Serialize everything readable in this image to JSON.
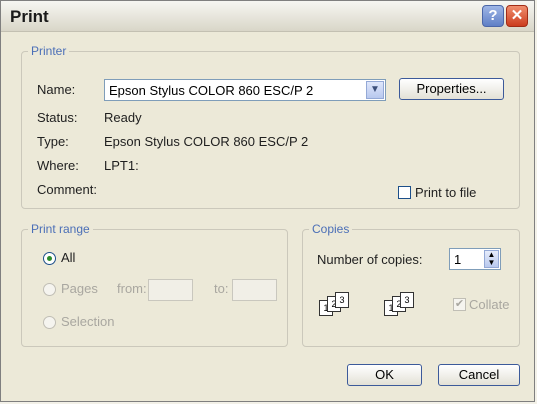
{
  "window": {
    "title": "Print",
    "help_glyph": "?",
    "close_glyph": "✕"
  },
  "printer": {
    "group_label": "Printer",
    "name_label": "Name:",
    "name_value": "Epson Stylus COLOR 860 ESC/P 2",
    "properties_label": "Properties...",
    "status_label": "Status:",
    "status_value": "Ready",
    "type_label": "Type:",
    "type_value": "Epson Stylus COLOR 860 ESC/P 2",
    "where_label": "Where:",
    "where_value": "LPT1:",
    "comment_label": "Comment:",
    "comment_value": "",
    "print_to_file_label": "Print to file"
  },
  "print_range": {
    "group_label": "Print range",
    "all_label": "All",
    "pages_label": "Pages",
    "from_label": "from:",
    "to_label": "to:",
    "from_value": "",
    "to_value": "",
    "selection_label": "Selection"
  },
  "copies": {
    "group_label": "Copies",
    "number_label": "Number of copies:",
    "number_value": "1",
    "collate_label": "Collate",
    "page_numbers": [
      "1",
      "2",
      "3"
    ]
  },
  "buttons": {
    "ok": "OK",
    "cancel": "Cancel"
  }
}
